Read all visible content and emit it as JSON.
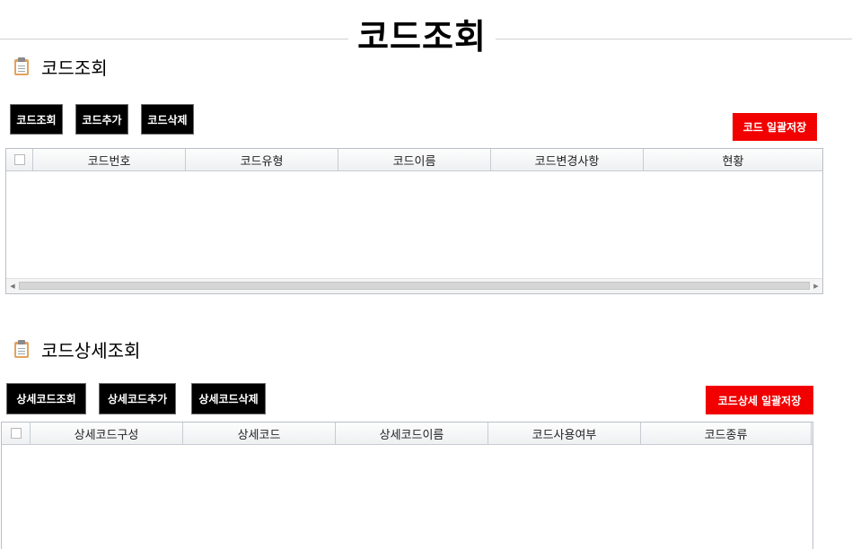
{
  "page": {
    "title": "코드조회"
  },
  "code_section": {
    "heading": "코드조회",
    "buttons": {
      "search": "코드조회",
      "add": "코드추가",
      "delete": "코드삭제",
      "save_all": "코드 일괄저장"
    },
    "columns": [
      "코드번호",
      "코드유형",
      "코드이름",
      "코드변경사항",
      "현황"
    ]
  },
  "detail_section": {
    "heading": "코드상세조회",
    "buttons": {
      "search": "상세코드조회",
      "add": "상세코드추가",
      "delete": "상세코드삭제",
      "save_all": "코드상세 일괄저장"
    },
    "columns": [
      "상세코드구성",
      "상세코드",
      "상세코드이름",
      "코드사용여부",
      "코드종류"
    ]
  },
  "icons": {
    "section_icon": "clipboard-icon",
    "scroll_left": "scroll-left-arrow-icon",
    "scroll_right": "scroll-right-arrow-icon"
  },
  "colors": {
    "primary_button": "#000000",
    "save_button": "#f20000",
    "grid_border": "#b9bfc7"
  }
}
